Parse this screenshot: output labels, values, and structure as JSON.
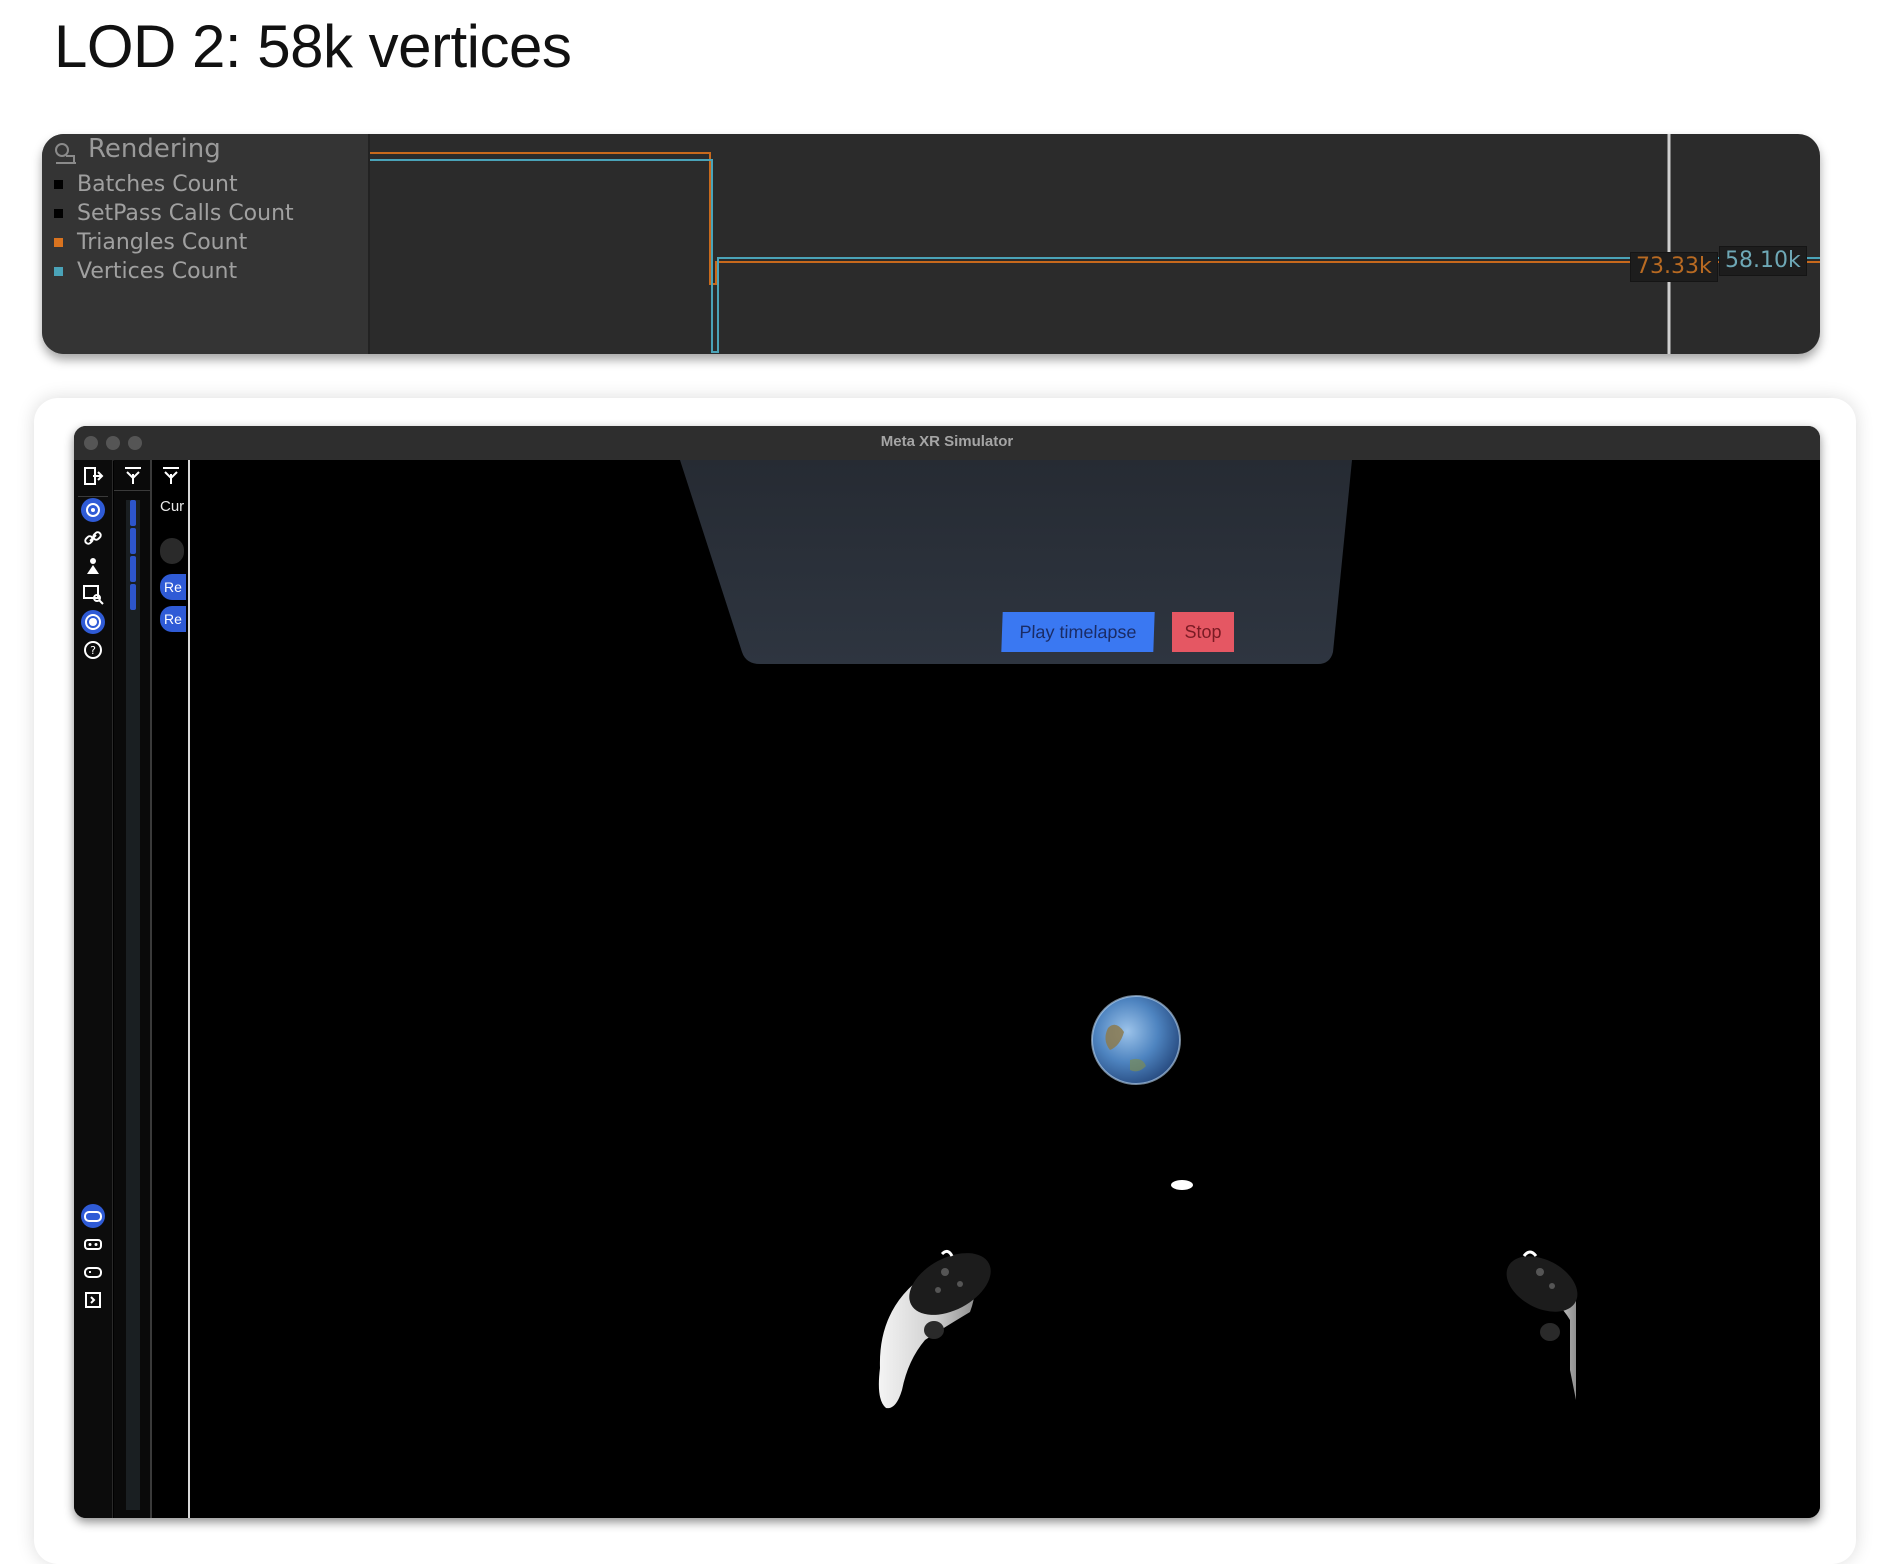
{
  "heading": "LOD 2: 58k vertices",
  "profiler": {
    "title": "Rendering",
    "legend": [
      {
        "label": "Batches Count",
        "color": "#000000"
      },
      {
        "label": "SetPass Calls Count",
        "color": "#000000"
      },
      {
        "label": "Triangles Count",
        "color": "#d9731f"
      },
      {
        "label": "Vertices Count",
        "color": "#4aa3b8"
      }
    ],
    "triangles_value": "73.33k",
    "vertices_value": "58.10k"
  },
  "simulator": {
    "window_title": "Meta XR Simulator",
    "panel_label": "Cur",
    "re_buttons": [
      "Re",
      "Re"
    ],
    "play_button": "Play timelapse",
    "stop_button": "Stop",
    "accent_color": "#2f5bd6"
  }
}
